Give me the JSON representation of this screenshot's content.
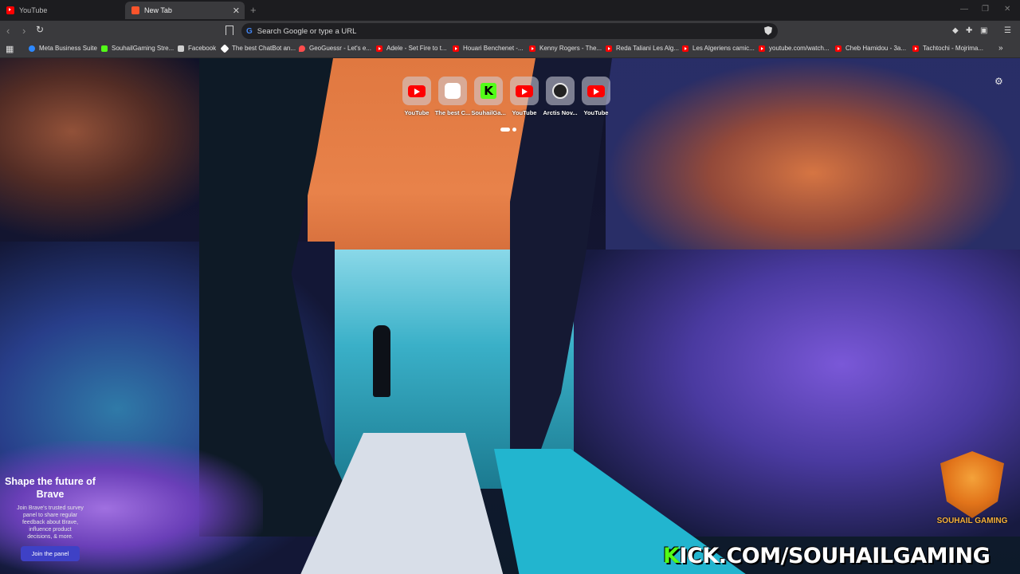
{
  "tabs": [
    {
      "title": "YouTube",
      "icon": "youtube-icon",
      "active": false
    },
    {
      "title": "New Tab",
      "icon": "brave-icon",
      "active": true
    }
  ],
  "toolbar": {
    "url_placeholder": "Search Google or type a URL"
  },
  "bookmarks": [
    {
      "label": "Meta Business Suite",
      "icon": "meta-icon",
      "color": "#2d88ff"
    },
    {
      "label": "SouhailGaming Stre...",
      "icon": "kick-icon",
      "color": "#53fc18"
    },
    {
      "label": "Facebook",
      "icon": "page-icon",
      "color": "#cfcfcf"
    },
    {
      "label": "The best ChatBot an...",
      "icon": "chatbot-icon",
      "color": "#ffffff"
    },
    {
      "label": "GeoGuessr - Let's e...",
      "icon": "geoguessr-icon",
      "color": "#ff4d4d"
    },
    {
      "label": "Adele - Set Fire to t...",
      "icon": "youtube-icon",
      "color": "#ff0000"
    },
    {
      "label": "Houari Benchenet -...",
      "icon": "youtube-icon",
      "color": "#ff0000"
    },
    {
      "label": "Kenny Rogers - The...",
      "icon": "youtube-icon",
      "color": "#ff0000"
    },
    {
      "label": "Reda Taliani Les Alg...",
      "icon": "youtube-icon",
      "color": "#ff0000"
    },
    {
      "label": "Les Algeriens camic...",
      "icon": "youtube-icon",
      "color": "#ff0000"
    },
    {
      "label": "youtube.com/watch...",
      "icon": "youtube-icon",
      "color": "#ff0000"
    },
    {
      "label": "Cheb Hamidou - 3a...",
      "icon": "youtube-icon",
      "color": "#ff0000"
    },
    {
      "label": "Tachtochi - Mojrima...",
      "icon": "youtube-icon",
      "color": "#ff0000"
    }
  ],
  "top_sites": [
    {
      "label": "YouTube",
      "icon": "youtube-icon"
    },
    {
      "label": "The best C...",
      "icon": "chatbot-icon"
    },
    {
      "label": "SouhailGa...",
      "icon": "kick-icon"
    },
    {
      "label": "YouTube",
      "icon": "youtube-icon"
    },
    {
      "label": "Arctis Nov...",
      "icon": "steelseries-icon"
    },
    {
      "label": "YouTube",
      "icon": "youtube-icon"
    }
  ],
  "survey_card": {
    "title": "Shape the future of Brave",
    "body": "Join Brave's trusted survey panel to share regular feedback about Brave, influence product decisions, & more.",
    "button": "Join the panel"
  },
  "watermark": {
    "logo_text": "SOUHAIL GAMING",
    "kick_first": "K",
    "kick_rest": "ICK.COM/SOUHAILGAMING"
  },
  "colors": {
    "accent": "#3e41c6",
    "kick_green": "#53fc18",
    "youtube_red": "#ff0000"
  }
}
